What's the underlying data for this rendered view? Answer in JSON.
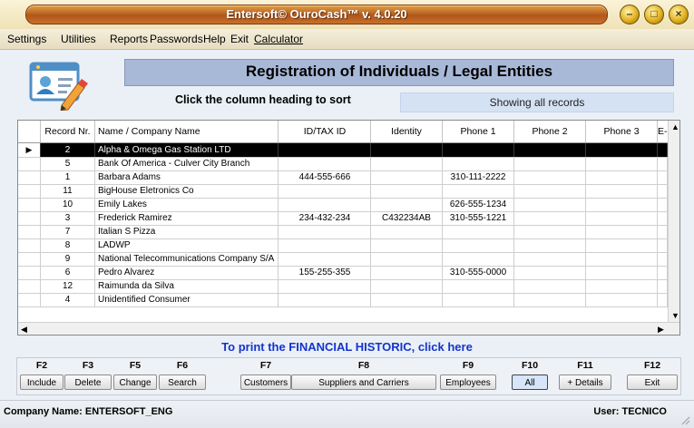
{
  "window": {
    "title": "Entersoft© OuroCash™ v. 4.0.20",
    "controls": [
      "minimize-icon",
      "maximize-icon",
      "close-icon"
    ]
  },
  "menu": [
    "Settings",
    "Utilities",
    "Reports",
    "Passwords",
    "Help",
    "Exit",
    "Calculator"
  ],
  "header": {
    "title": "Registration of Individuals / Legal Entities",
    "sort_hint": "Click the column heading to sort",
    "filter_status": "Showing all records"
  },
  "grid": {
    "columns": [
      "Record Nr.",
      "Name / Company Name",
      "ID/TAX ID",
      "Identity",
      "Phone 1",
      "Phone 2",
      "Phone 3",
      "E-"
    ],
    "rows": [
      {
        "rec": "2",
        "name": "Alpha & Omega Gas Station LTD",
        "tax": "",
        "identity": "",
        "p1": "",
        "p2": "",
        "p3": ""
      },
      {
        "rec": "5",
        "name": "Bank Of America - Culver City Branch",
        "tax": "",
        "identity": "",
        "p1": "",
        "p2": "",
        "p3": ""
      },
      {
        "rec": "1",
        "name": "Barbara Adams",
        "tax": "444-555-666",
        "identity": "",
        "p1": "310-111-2222",
        "p2": "",
        "p3": ""
      },
      {
        "rec": "11",
        "name": "BigHouse Eletronics Co",
        "tax": "",
        "identity": "",
        "p1": "",
        "p2": "",
        "p3": ""
      },
      {
        "rec": "10",
        "name": "Emily Lakes",
        "tax": "",
        "identity": "",
        "p1": "626-555-1234",
        "p2": "",
        "p3": ""
      },
      {
        "rec": "3",
        "name": "Frederick Ramirez",
        "tax": "234-432-234",
        "identity": "C432234AB",
        "p1": "310-555-1221",
        "p2": "",
        "p3": ""
      },
      {
        "rec": "7",
        "name": "Italian S Pizza",
        "tax": "",
        "identity": "",
        "p1": "",
        "p2": "",
        "p3": ""
      },
      {
        "rec": "8",
        "name": "LADWP",
        "tax": "",
        "identity": "",
        "p1": "",
        "p2": "",
        "p3": ""
      },
      {
        "rec": "9",
        "name": "National Telecommunications Company S/A",
        "tax": "",
        "identity": "",
        "p1": "",
        "p2": "",
        "p3": ""
      },
      {
        "rec": "6",
        "name": "Pedro Alvarez",
        "tax": "155-255-355",
        "identity": "",
        "p1": "310-555-0000",
        "p2": "",
        "p3": ""
      },
      {
        "rec": "12",
        "name": "Raimunda da Silva",
        "tax": "",
        "identity": "",
        "p1": "",
        "p2": "",
        "p3": ""
      },
      {
        "rec": "4",
        "name": "Unidentified Consumer",
        "tax": "",
        "identity": "",
        "p1": "",
        "p2": "",
        "p3": ""
      }
    ],
    "selected_index": 0
  },
  "print_link": "To print the FINANCIAL HISTORIC, click here",
  "fkeys": [
    {
      "key": "F2",
      "label": "Include"
    },
    {
      "key": "F3",
      "label": "Delete"
    },
    {
      "key": "F5",
      "label": "Change"
    },
    {
      "key": "F6",
      "label": "Search"
    },
    {
      "key": "F7",
      "label": "Customers"
    },
    {
      "key": "F8",
      "label": "Suppliers and Carriers"
    },
    {
      "key": "F9",
      "label": "Employees"
    },
    {
      "key": "F10",
      "label": "All"
    },
    {
      "key": "F11",
      "label": "+ Details"
    },
    {
      "key": "F12",
      "label": "Exit"
    }
  ],
  "status": {
    "company": "Company Name: ENTERSOFT_ENG",
    "user": "User: TECNICO"
  }
}
